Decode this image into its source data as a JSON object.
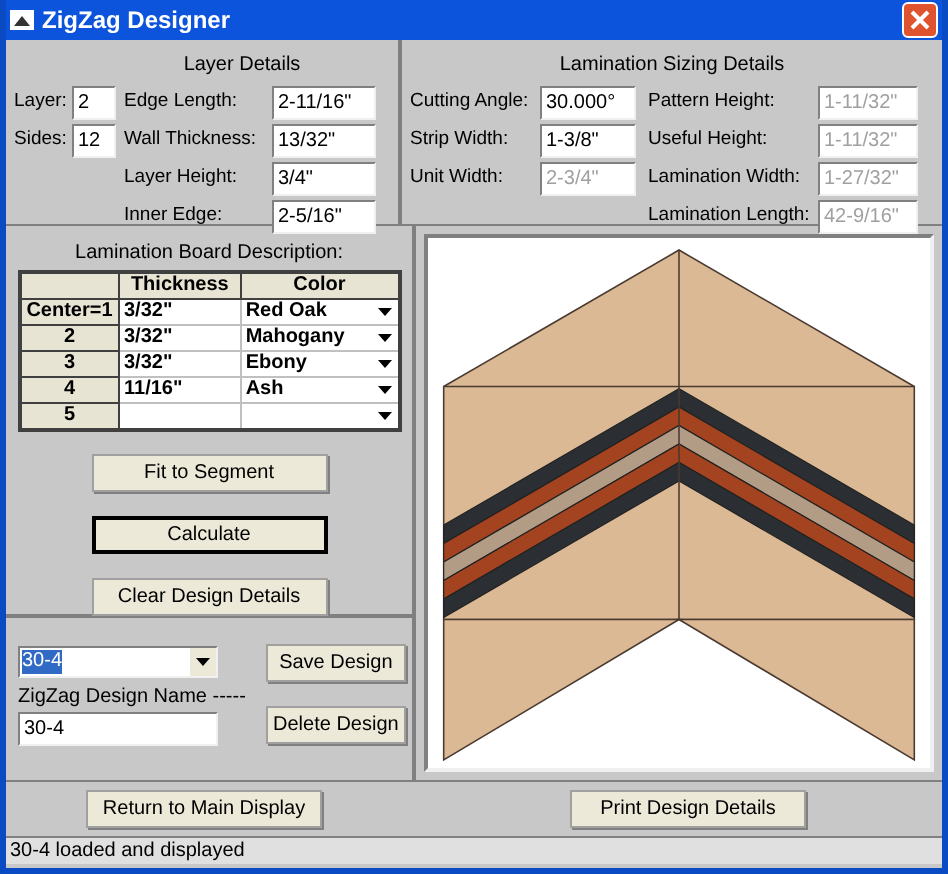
{
  "window": {
    "title": "ZigZag Designer"
  },
  "layer_details": {
    "title": "Layer Details",
    "small_fields": [
      {
        "label": "Layer:",
        "value": "2"
      },
      {
        "label": "Sides:",
        "value": "12"
      }
    ],
    "fields": [
      {
        "label": "Edge Length:",
        "value": "2-11/16\""
      },
      {
        "label": "Wall Thickness:",
        "value": "13/32\""
      },
      {
        "label": "Layer Height:",
        "value": "3/4\""
      },
      {
        "label": "Inner Edge:",
        "value": "2-5/16\""
      }
    ]
  },
  "lamination_sizing": {
    "title": "Lamination Sizing Details",
    "left_fields": [
      {
        "label": "Cutting Angle:",
        "value": "30.000°",
        "disabled": false
      },
      {
        "label": "Strip Width:",
        "value": "1-3/8\"",
        "disabled": false
      },
      {
        "label": "Unit Width:",
        "value": "2-3/4\"",
        "disabled": true
      }
    ],
    "right_fields": [
      {
        "label": "Pattern Height:",
        "value": "1-11/32\"",
        "disabled": true
      },
      {
        "label": "Useful Height:",
        "value": "1-11/32\"",
        "disabled": true
      },
      {
        "label": "Lamination Width:",
        "value": "1-27/32\"",
        "disabled": true
      },
      {
        "label": "Lamination Length:",
        "value": "42-9/16\"",
        "disabled": true
      }
    ]
  },
  "board_table": {
    "title": "Lamination Board Description:",
    "columns": [
      "Thickness",
      "Color"
    ],
    "rows": [
      {
        "header": "Center=1",
        "thickness": "3/32\"",
        "wood": "Red Oak"
      },
      {
        "header": "2",
        "thickness": "3/32\"",
        "wood": "Mahogany"
      },
      {
        "header": "3",
        "thickness": "3/32\"",
        "wood": "Ebony"
      },
      {
        "header": "4",
        "thickness": "11/16\"",
        "wood": "Ash"
      },
      {
        "header": "5",
        "thickness": "",
        "wood": ""
      }
    ]
  },
  "action_buttons": [
    {
      "label": "Fit to Segment",
      "default": false
    },
    {
      "label": "Calculate",
      "default": true
    },
    {
      "label": "Clear Design Details",
      "default": false
    }
  ],
  "design": {
    "combo_value": "30-4",
    "name_label": "ZigZag Design Name -----",
    "name_value": "30-4",
    "buttons": [
      "Save Design",
      "Delete Design"
    ]
  },
  "stripes": [
    {
      "color": "#2b2f33"
    },
    {
      "color": "#a4431f"
    },
    {
      "color": "#b39c86"
    },
    {
      "color": "#a4431f"
    },
    {
      "color": "#2b2f33"
    }
  ],
  "bottom_buttons": [
    "Return to Main Display",
    "Print Design Details"
  ],
  "status_bar": "30-4 loaded and displayed"
}
